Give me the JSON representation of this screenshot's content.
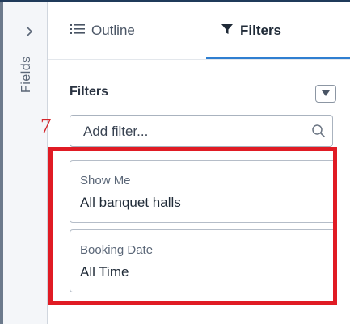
{
  "rail": {
    "label": "Fields",
    "chevron_icon": "chevron-right-icon"
  },
  "tabs": [
    {
      "label": "Outline",
      "icon": "list-icon",
      "active": false
    },
    {
      "label": "Filters",
      "icon": "funnel-icon",
      "active": true
    }
  ],
  "filters_panel": {
    "title": "Filters",
    "dropdown_icon": "caret-down-icon",
    "add_filter": {
      "placeholder": "Add filter...",
      "value": ""
    },
    "search_icon": "search-icon",
    "filters": [
      {
        "label": "Show Me",
        "value": "All banquet halls"
      },
      {
        "label": "Booking Date",
        "value": "All Time"
      }
    ]
  },
  "annotation": {
    "number": "7",
    "color": "#e01b24"
  },
  "colors": {
    "accent": "#2f7fd1",
    "highlight": "#e01b24"
  }
}
